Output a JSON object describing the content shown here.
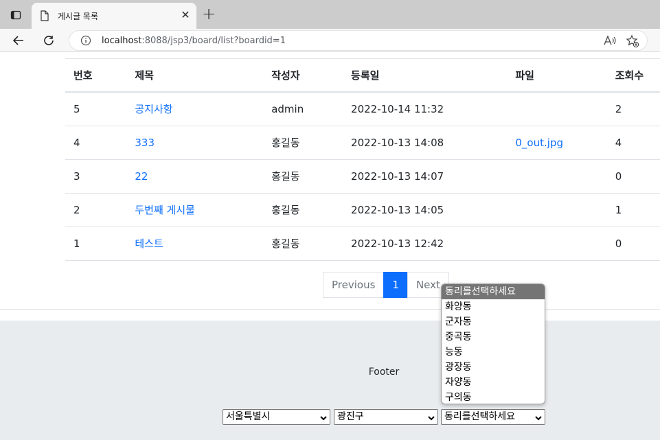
{
  "browser": {
    "tab_title": "게시글 목록",
    "url_host": "localhost",
    "url_rest": ":8088/jsp3/board/list?boardid=1"
  },
  "table": {
    "headers": [
      "번호",
      "제목",
      "작성자",
      "등록일",
      "파일",
      "조회수"
    ],
    "rows": [
      {
        "no": "5",
        "title": "공지사항",
        "author": "admin",
        "date": "2022-10-14 11:32",
        "file": "",
        "views": "2"
      },
      {
        "no": "4",
        "title": "333",
        "author": "홍길동",
        "date": "2022-10-13 14:08",
        "file": "0_out.jpg",
        "views": "4"
      },
      {
        "no": "3",
        "title": "22",
        "author": "홍길동",
        "date": "2022-10-13 14:07",
        "file": "",
        "views": "0"
      },
      {
        "no": "2",
        "title": "두번째 게시물",
        "author": "홍길동",
        "date": "2022-10-13 14:05",
        "file": "",
        "views": "1"
      },
      {
        "no": "1",
        "title": "테스트",
        "author": "홍길동",
        "date": "2022-10-13 12:42",
        "file": "",
        "views": "0"
      }
    ]
  },
  "pagination": {
    "previous": "Previous",
    "current": "1",
    "next": "Next"
  },
  "footer": {
    "text": "Footer",
    "city_select": "서울특별시",
    "district_select": "광진구",
    "dong_select": "동리를선택하세요"
  },
  "dong_dropdown": {
    "options": [
      "동리를선택하세요",
      "화양동",
      "군자동",
      "중곡동",
      "능동",
      "광장동",
      "자양동",
      "구의동"
    ]
  }
}
